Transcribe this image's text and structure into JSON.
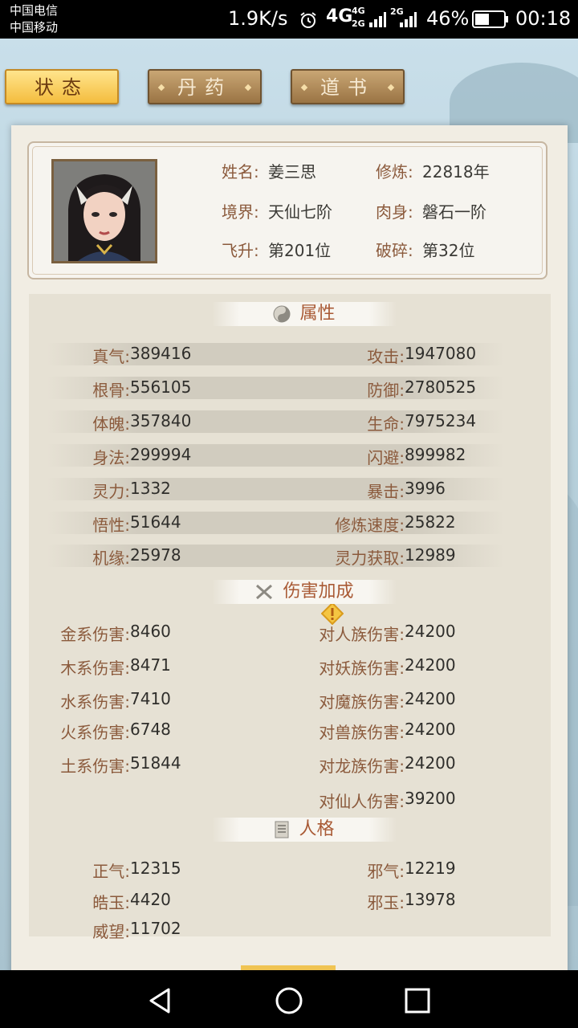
{
  "statusbar": {
    "carrier1": "中国电信",
    "carrier2": "中国移动",
    "net_speed": "1.9K/s",
    "network": "4G",
    "network_small_top": "4G",
    "network_small_bottom": "2G",
    "network_2g": "2G",
    "battery": "46%",
    "time": "00:18"
  },
  "tabs": [
    {
      "label": "状态",
      "active": true
    },
    {
      "label": "丹药",
      "active": false
    },
    {
      "label": "道书",
      "active": false
    }
  ],
  "profile": {
    "name_label": "姓名:",
    "name": "姜三思",
    "cultivation_label": "修炼:",
    "cultivation": "22818年",
    "realm_label": "境界:",
    "realm": "天仙七阶",
    "body_label": "肉身:",
    "body": "磐石一阶",
    "ascend_label": "飞升:",
    "ascend": "第201位",
    "break_label": "破碎:",
    "break": "第32位"
  },
  "attributes": {
    "title": "属性",
    "left": [
      {
        "label": "真气:",
        "value": "389416"
      },
      {
        "label": "根骨:",
        "value": "556105"
      },
      {
        "label": "体魄:",
        "value": "357840"
      },
      {
        "label": "身法:",
        "value": "299994"
      },
      {
        "label": "灵力:",
        "value": "1332"
      },
      {
        "label": "悟性:",
        "value": "51644"
      },
      {
        "label": "机缘:",
        "value": "25978"
      }
    ],
    "right": [
      {
        "label": "攻击:",
        "value": "1947080"
      },
      {
        "label": "防御:",
        "value": "2780525"
      },
      {
        "label": "生命:",
        "value": "7975234"
      },
      {
        "label": "闪避:",
        "value": "899982"
      },
      {
        "label": "暴击:",
        "value": "3996"
      },
      {
        "label": "修炼速度:",
        "value": "25822"
      },
      {
        "label": "灵力获取:",
        "value": "12989"
      }
    ]
  },
  "damage": {
    "title": "伤害加成",
    "left": [
      {
        "label": "金系伤害:",
        "value": "8460"
      },
      {
        "label": "木系伤害:",
        "value": "8471"
      },
      {
        "label": "水系伤害:",
        "value": "7410"
      },
      {
        "label": "火系伤害:",
        "value": "6748"
      },
      {
        "label": "土系伤害:",
        "value": "51844"
      }
    ],
    "right": [
      {
        "label": "对人族伤害:",
        "value": "24200"
      },
      {
        "label": "对妖族伤害:",
        "value": "24200"
      },
      {
        "label": "对魔族伤害:",
        "value": "24200"
      },
      {
        "label": "对兽族伤害:",
        "value": "24200"
      },
      {
        "label": "对龙族伤害:",
        "value": "24200"
      },
      {
        "label": "对仙人伤害:",
        "value": "39200"
      }
    ]
  },
  "personality": {
    "title": "人格",
    "left": [
      {
        "label": "正气:",
        "value": "12315"
      },
      {
        "label": "皓玉:",
        "value": "4420"
      },
      {
        "label": "威望:",
        "value": "11702"
      }
    ],
    "right": [
      {
        "label": "邪气:",
        "value": "12219"
      },
      {
        "label": "邪玉:",
        "value": "13978"
      }
    ]
  },
  "icons": {
    "alarm": "alarm-icon",
    "warning": "warning-icon",
    "yinyang": "yinyang-icon",
    "swords": "crossed-swords-icon",
    "book": "book-icon"
  },
  "colors": {
    "label": "#8b5a3c",
    "value": "#2f2e2b",
    "active_tab": "#f4bd3e"
  }
}
